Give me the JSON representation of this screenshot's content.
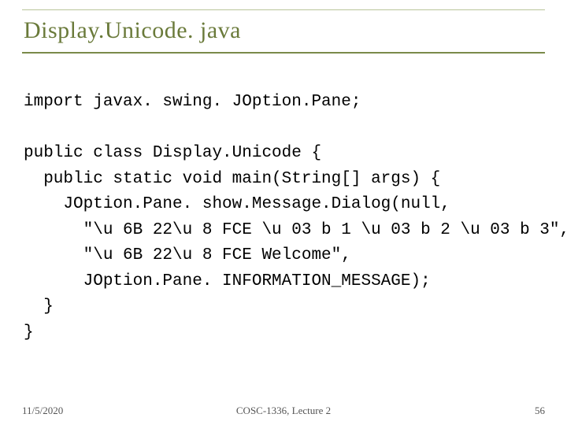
{
  "title": "Display.Unicode. java",
  "code": {
    "l1": "import javax. swing. JOption.Pane;",
    "blank1": "",
    "l2": "public class Display.Unicode {",
    "l3": "  public static void main(String[] args) {",
    "l4": "    JOption.Pane. show.Message.Dialog(null,",
    "l5": "      \"\\u 6B 22\\u 8 FCE \\u 03 b 1 \\u 03 b 2 \\u 03 b 3\",",
    "l6": "      \"\\u 6B 22\\u 8 FCE Welcome\",",
    "l7": "      JOption.Pane. INFORMATION_MESSAGE); ",
    "l8": "  }",
    "l9": "}"
  },
  "footer": {
    "date": "11/5/2020",
    "center": "COSC-1336, Lecture 2",
    "page": "56"
  }
}
